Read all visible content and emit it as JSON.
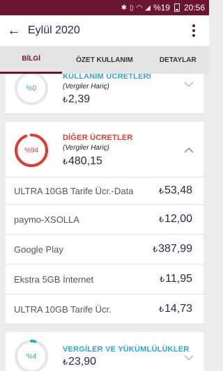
{
  "status_bar": {
    "icons": [
      "bluetooth-icon",
      "vibrate-icon",
      "wifi-icon",
      "signal-icon"
    ],
    "battery": "%19",
    "time": "20:56"
  },
  "app_bar": {
    "title": "Eylül 2020",
    "back_icon": "arrow-left-icon",
    "menu_icon": "more-vertical-icon"
  },
  "tabs": [
    {
      "label": "BİLGİ",
      "active": true
    },
    {
      "label": "ÖZET KULLANIM",
      "active": false
    },
    {
      "label": "DETAYLAR",
      "active": false
    }
  ],
  "currency_symbol": "₺",
  "sections": [
    {
      "title": "KULLANIM ÜCRETLERİ",
      "subtitle": "(Vergiler Hariç)",
      "amount": "2,39",
      "percent_label": "%0",
      "percent": 0,
      "color": "#2aa6d8",
      "expanded": false
    },
    {
      "title": "DİĞER ÜCRETLER",
      "subtitle": "(Vergiler Hariç)",
      "amount": "480,15",
      "percent_label": "%94",
      "percent": 94,
      "color": "#e23a2e",
      "expanded": true,
      "items": [
        {
          "name": "ULTRA 10GB Tarife Ücr.-Data",
          "value": "53,48"
        },
        {
          "name": "paymo-XSOLLA",
          "value": "12,00"
        },
        {
          "name": "Google Play",
          "value": "387,99"
        },
        {
          "name": "Ekstra 5GB İnternet",
          "value": "11,95"
        },
        {
          "name": "ULTRA 10GB Tarife Ücr.",
          "value": "14,73"
        }
      ]
    },
    {
      "title": "VERGİLER VE YÜKÜMLÜLÜKLER",
      "subtitle": "",
      "amount": "23,90",
      "percent_label": "%4",
      "percent": 4,
      "color": "#2aa6d8",
      "expanded": false
    }
  ]
}
